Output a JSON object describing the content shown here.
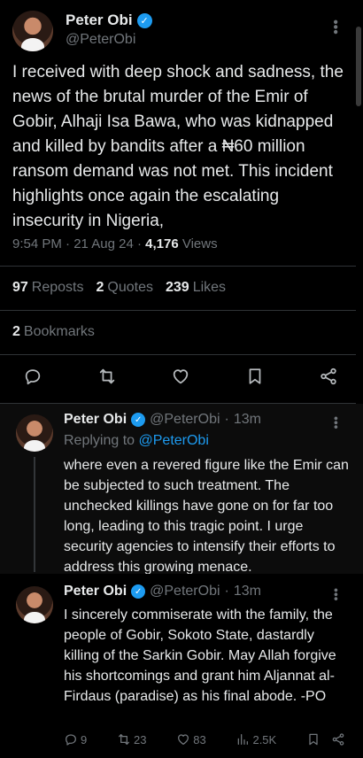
{
  "main_tweet": {
    "author_name": "Peter Obi",
    "verified_mark": "✓",
    "handle": "@PeterObi",
    "text": "I received with deep shock and sadness, the news of the brutal murder of the Emir of Gobir, Alhaji Isa Bawa, who was kidnapped and killed by bandits after a ₦60 million ransom demand was not met. This incident highlights once again the escalating insecurity in Nigeria,",
    "time": "9:54 PM",
    "date": "21 Aug 24",
    "views_count": "4,176",
    "views_label": "Views",
    "reposts_count": "97",
    "reposts_label": "Reposts",
    "quotes_count": "2",
    "quotes_label": "Quotes",
    "likes_count": "239",
    "likes_label": "Likes",
    "bookmarks_count": "2",
    "bookmarks_label": "Bookmarks",
    "action_icons": [
      "reply-icon",
      "repost-icon",
      "like-icon",
      "bookmark-icon",
      "share-icon"
    ]
  },
  "replies": [
    {
      "author_name": "Peter Obi",
      "verified_mark": "✓",
      "handle": "@PeterObi",
      "separator": "·",
      "time_ago": "13m",
      "replying_prefix": "Replying to",
      "replying_handle": "@PeterObi",
      "text": "where even a revered figure like the Emir can be subjected to such treatment. The unchecked killings have gone on for far too long, leading to this tragic point. I urge security agencies to intensify their efforts to address this growing menace."
    },
    {
      "author_name": "Peter Obi",
      "verified_mark": "✓",
      "handle": "@PeterObi",
      "separator": "·",
      "time_ago": "13m",
      "text": "I sincerely commiserate with the family, the people of Gobir, Sokoto State, dastardly killing of the Sarkin Gobir. May Allah forgive his shortcomings and grant him Aljannat al-Firdaus (paradise) as his final abode. -PO",
      "reply_count": "9",
      "repost_count": "23",
      "like_count": "83",
      "view_count": "2.5K"
    }
  ],
  "colors": {
    "background": "#000000",
    "text_primary": "#e7e9ea",
    "text_secondary": "#71767b",
    "accent": "#1d9bf0",
    "divider": "#2f3336"
  }
}
